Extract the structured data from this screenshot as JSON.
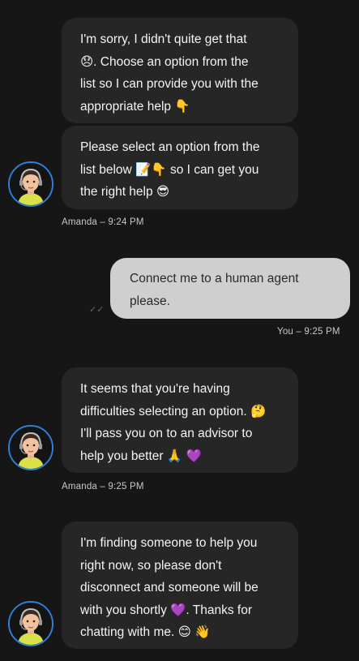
{
  "conversation": {
    "agent_name": "Amanda",
    "messages": [
      {
        "sender": "bot",
        "lines": [
          "I'm sorry, I didn't quite get that",
          "😞. Choose an option from the",
          "list so I can provide you with the",
          "appropriate help 👇"
        ]
      },
      {
        "sender": "bot",
        "lines": [
          "Please select an option from the",
          "list below 📝👇 so I can get you",
          "the right help 😎"
        ]
      },
      {
        "sender": "user",
        "lines": [
          "Connect me to a human agent",
          "please."
        ]
      },
      {
        "sender": "bot",
        "lines": [
          "It seems that you're having",
          "difficulties selecting an option. 🤔",
          "I'll pass you on to an advisor to",
          "help you better 🙏 💜"
        ]
      },
      {
        "sender": "bot",
        "lines": [
          "I'm finding someone to help you",
          "right now, so please don't",
          "disconnect and someone will be",
          "with you shortly 💜. Thanks for",
          "chatting with me. 😊 👋"
        ]
      }
    ],
    "timestamps": {
      "group1": "Amanda – 9:24 PM",
      "user1": "You – 9:25 PM",
      "group2": "Amanda – 9:25 PM"
    },
    "read_receipt": "✓✓"
  },
  "colors": {
    "background": "#161616",
    "bot_bubble": "#262626",
    "user_bubble": "#cfcfcf",
    "avatar_ring": "#2f7fd6"
  },
  "icons": {
    "avatar": "agent-avatar-headset",
    "read_receipt": "double-check-icon"
  }
}
